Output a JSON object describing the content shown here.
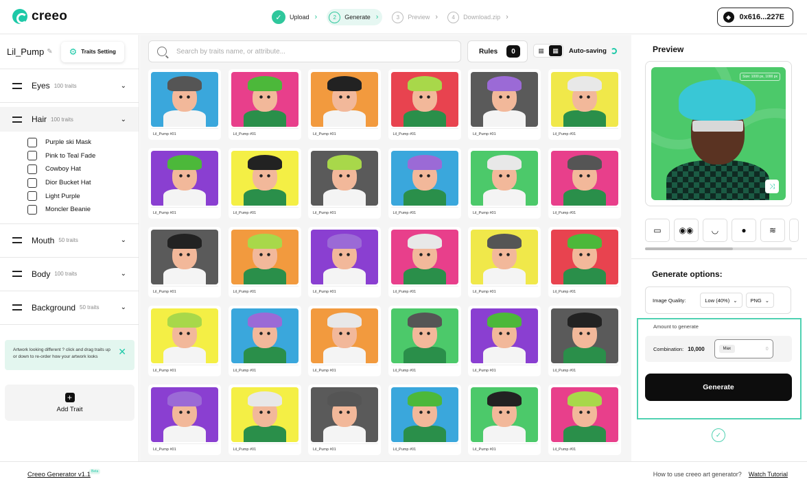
{
  "app": {
    "logo_text": "creeo",
    "steps": [
      {
        "num": "✓",
        "label": "Upload",
        "state": "done"
      },
      {
        "num": "2",
        "label": "Generate",
        "state": "active"
      },
      {
        "num": "3",
        "label": "Preview",
        "state": "todo"
      },
      {
        "num": "4",
        "label": "Download.zip",
        "state": "todo"
      }
    ],
    "wallet": "0x616...227E"
  },
  "sidebar": {
    "project_name": "Lil_Pump",
    "traits_setting_label": "Traits Setting",
    "groups": [
      {
        "name": "Eyes",
        "count": "100 traits",
        "open": false
      },
      {
        "name": "Hair",
        "count": "100 traits",
        "open": true,
        "options": [
          "Purple ski Mask",
          "Pink to Teal Fade",
          "Cowboy Hat",
          "Dior Bucket Hat",
          "Light Purple",
          "Moncler Beanie"
        ]
      },
      {
        "name": "Mouth",
        "count": "50 traits",
        "open": false
      },
      {
        "name": "Body",
        "count": "100 traits",
        "open": false
      },
      {
        "name": "Background",
        "count": "50 traits",
        "open": false
      }
    ],
    "tip": "Artwork looking different ? click and drag traits up or down to re-order how your artwork looks",
    "add_trait_label": "Add Trait"
  },
  "main": {
    "search_placeholder": "Search by traits name, or attribute...",
    "rules_label": "Rules",
    "rules_count": "0",
    "autosave_label": "Auto-saving",
    "card_label": "Lil_Pump #01",
    "palette": [
      [
        "#3aa7dc",
        "#e83f8b",
        "#f29a3e",
        "#e8434f",
        "#5a5a5a",
        "#f0e84a"
      ],
      [
        "#8a3fd1",
        "#f4ef45",
        "#5a5a5a",
        "#3aa7dc",
        "#4cc96a",
        "#e83f8b"
      ],
      [
        "#5a5a5a",
        "#f29a3e",
        "#8a3fd1",
        "#e83f8b",
        "#f0e84a",
        "#e8434f"
      ],
      [
        "#f4ef45",
        "#3aa7dc",
        "#f29a3e",
        "#4cc96a",
        "#8a3fd1",
        "#5a5a5a"
      ],
      [
        "#8a3fd1",
        "#f4ef45",
        "#5a5a5a",
        "#3aa7dc",
        "#4cc96a",
        "#e83f8b"
      ]
    ],
    "hair_colors": [
      "#555555",
      "#4cb83a",
      "#222222",
      "#a8d84a",
      "#9b6ad6",
      "#e8e8e8"
    ]
  },
  "preview": {
    "title": "Preview",
    "size_tag": "Size: 1000 px, 1000 px",
    "thumbs": [
      "▭",
      "◉◉",
      "◡",
      "●",
      "≋",
      ""
    ],
    "generate_options_title": "Generate options:",
    "image_quality_label": "Image Quality:",
    "quality_value": "Low (40%)",
    "format_value": "PNG",
    "amount_label": "Amount to generate",
    "combination_label": "Combination:",
    "combination_value": "10,000",
    "max_label": "Max",
    "max_value": "0",
    "generate_label": "Generate"
  },
  "footer": {
    "version": "Creeo Generator v1.1",
    "beta": "Beta",
    "how_to": "How to use creeo art generator?",
    "tutorial": "Watch Tutorial"
  }
}
